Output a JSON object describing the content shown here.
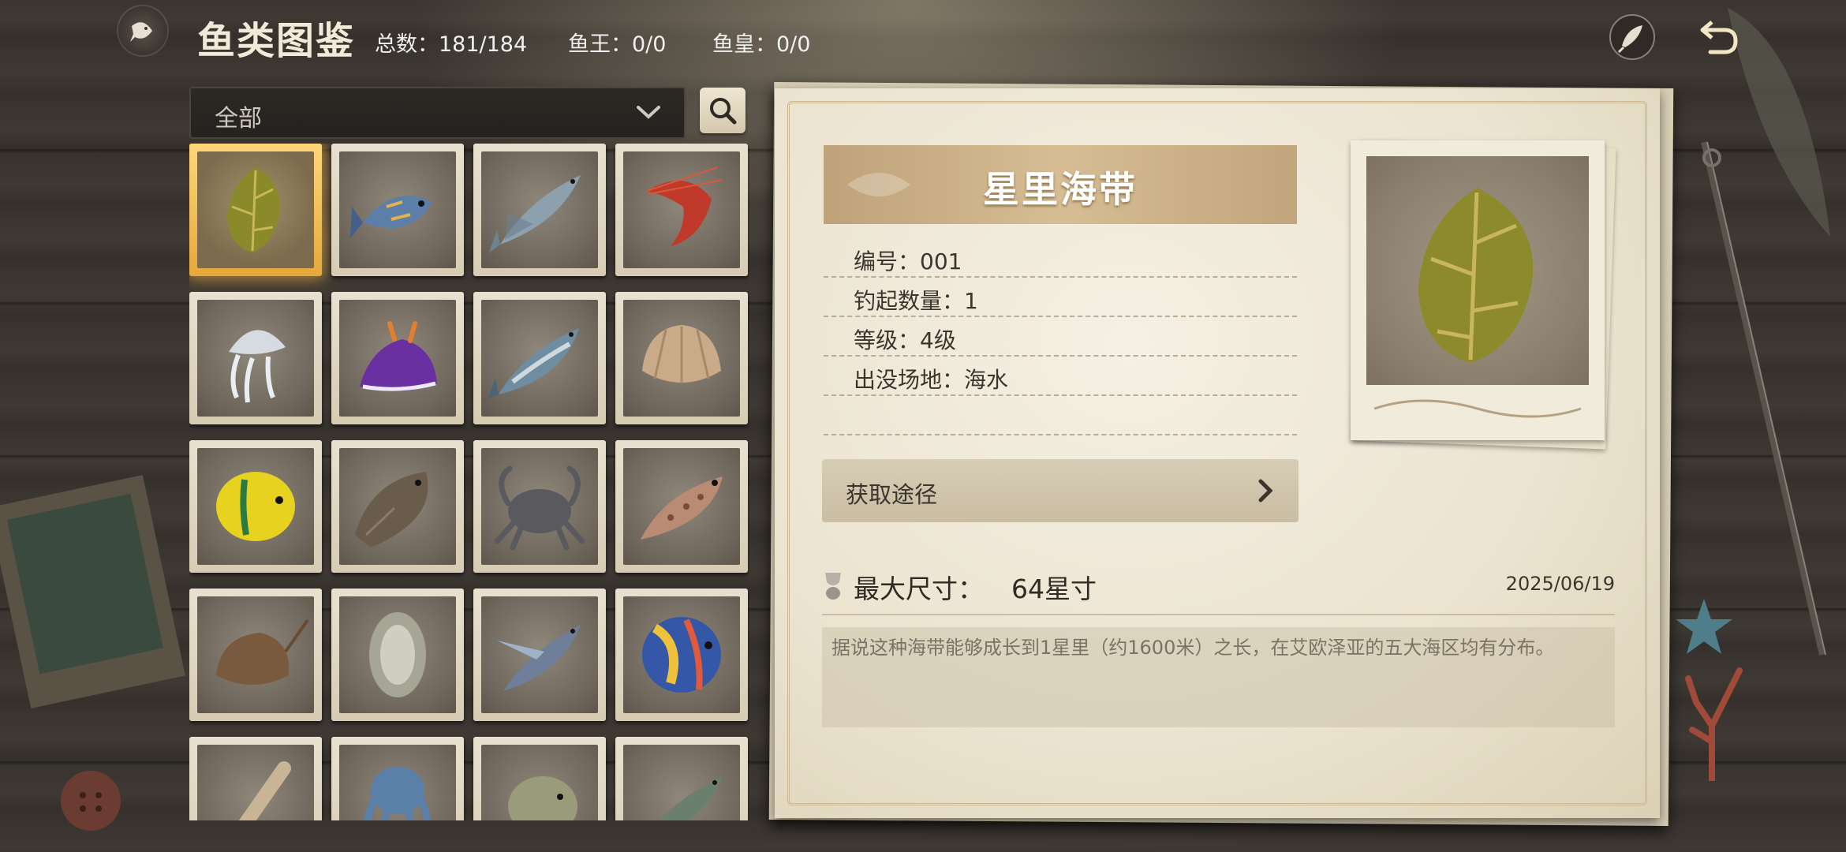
{
  "header": {
    "title": "鱼类图鉴",
    "total": "总数：181/184",
    "fish_king": "鱼王：0/0",
    "fish_emperor": "鱼皇：0/0"
  },
  "filter": {
    "selected": "全部"
  },
  "grid": {
    "items": [
      {
        "icon": "kelp-icon",
        "selected": true
      },
      {
        "icon": "blue-fish-icon"
      },
      {
        "icon": "sardine-icon"
      },
      {
        "icon": "shrimp-icon"
      },
      {
        "icon": "jellyfish-icon"
      },
      {
        "icon": "sea-slug-icon"
      },
      {
        "icon": "herring-icon"
      },
      {
        "icon": "clam-icon"
      },
      {
        "icon": "butterflyfish-icon"
      },
      {
        "icon": "flounder-icon"
      },
      {
        "icon": "crab-icon"
      },
      {
        "icon": "grouper-icon"
      },
      {
        "icon": "horseshoe-crab-icon"
      },
      {
        "icon": "oyster-icon"
      },
      {
        "icon": "flying-fish-icon"
      },
      {
        "icon": "angelfish-icon"
      },
      {
        "icon": "razor-clam-icon"
      },
      {
        "icon": "octopus-icon"
      },
      {
        "icon": "pufferfish-icon"
      },
      {
        "icon": "mackerel-icon"
      }
    ]
  },
  "detail": {
    "name": "星里海带",
    "number": "编号：001",
    "caught_count": "钓起数量：1",
    "level": "等级：4级",
    "habitat": "出没场地：海水",
    "obtain_label": "获取途径",
    "max_size_label": "最大尺寸：",
    "max_size_value": "64星寸",
    "date": "2025/06/19",
    "description": "据说这种海带能够成长到1星里（约1600米）之长，在艾欧泽亚的五大海区均有分布。"
  },
  "colors": {
    "selected_glow": "#ffbe46",
    "panel_paper": "#f5f0e4",
    "banner": "#c9ad84"
  }
}
